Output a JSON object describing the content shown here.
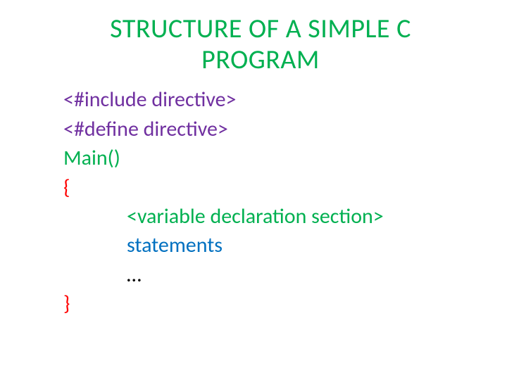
{
  "title": "STRUCTURE OF A SIMPLE C PROGRAM",
  "lines": {
    "include": "<#include directive>",
    "define": "<#define directive>",
    "main": "Main()",
    "open_brace": "{",
    "var_decl": "<variable declaration section>",
    "statements": "statements",
    "ellipsis": "…",
    "close_brace": "}"
  }
}
